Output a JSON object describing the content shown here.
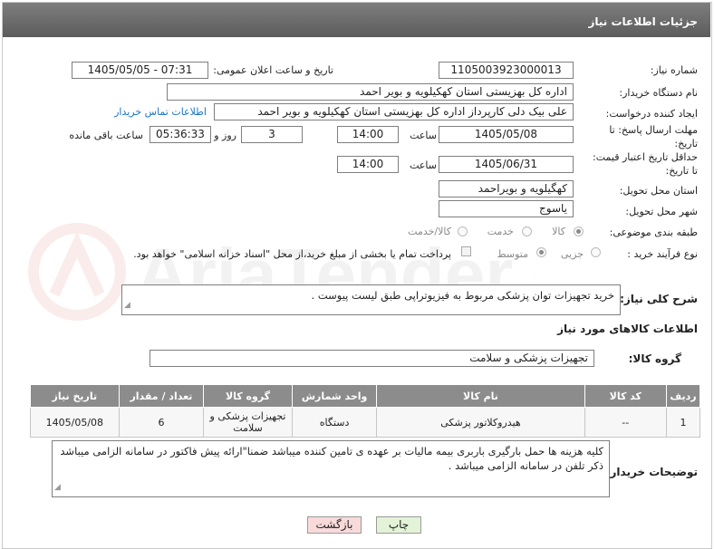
{
  "header": {
    "title": "جزئیات اطلاعات نیاز"
  },
  "watermark": {
    "text": "AriaTender.net"
  },
  "form": {
    "need_number": {
      "label": "شماره نیاز:",
      "value": "1105003923000013"
    },
    "announce_datetime": {
      "label": "تاریخ و ساعت اعلان عمومی:",
      "value": "1405/05/05 - 07:31"
    },
    "buyer_org": {
      "label": "نام دستگاه خریدار:",
      "value": "اداره کل بهزیستی استان کهکیلویه و بویر احمد"
    },
    "requester": {
      "label": "ایجاد کننده درخواست:",
      "value": "علی بیک دلی کارپرداز اداره کل بهزیستی استان کهکیلویه و بویر احمد",
      "contact_link": "اطلاعات تماس خریدار"
    },
    "deadline": {
      "label_line1": "مهلت ارسال پاسخ: تا",
      "label_line2": "تاریخ:",
      "date": "1405/05/08",
      "time_label": "ساعت",
      "time": "14:00",
      "days": "3",
      "days_label": "روز و",
      "remaining": "05:36:33",
      "remaining_label": "ساعت باقی مانده"
    },
    "price_validity": {
      "label_line1": "حداقل تاریخ اعتبار قیمت:",
      "label_line2": "تا تاریخ:",
      "date": "1405/06/31",
      "time_label": "ساعت",
      "time": "14:00"
    },
    "province": {
      "label": "استان محل تحویل:",
      "value": "کهگیلویه و بویراحمد"
    },
    "city": {
      "label": "شهر محل تحویل:",
      "value": "یاسوج"
    },
    "category": {
      "label": "طبقه بندی موضوعی:",
      "options": [
        {
          "label": "کالا",
          "selected": true
        },
        {
          "label": "خدمت",
          "selected": false
        },
        {
          "label": "کالا/خدمت",
          "selected": false
        }
      ]
    },
    "purchase_process": {
      "label": "نوع فرآیند خرید :",
      "options": [
        {
          "label": "جزیی",
          "selected": false
        },
        {
          "label": "متوسط",
          "selected": true
        }
      ],
      "payment_note": "پرداخت تمام یا بخشی از مبلغ خرید،از محل \"اسناد خزانه اسلامی\" خواهد بود."
    },
    "general_description": {
      "label": "شرح کلی نیاز:",
      "value": "خرید تجهیزات توان پزشکی مربوط به فیزیوتراپی طبق لیست پیوست ."
    }
  },
  "goods_section": {
    "title": "اطلاعات کالاهای مورد نیاز",
    "group_label": "گروه کالا:",
    "group_value": "تجهیزات پزشکی و سلامت",
    "columns": [
      "ردیف",
      "کد کالا",
      "نام کالا",
      "واحد شمارش",
      "گروه کالا",
      "تعداد / مقدار",
      "تاریخ نیاز"
    ],
    "rows": [
      [
        "1",
        "--",
        "هیدروکلاتور پزشکی",
        "دستگاه",
        "تجهیزات پزشکی و سلامت",
        "6",
        "1405/05/08"
      ]
    ]
  },
  "buyer_notes": {
    "label": "توضیحات خریدار:",
    "value": "کلیه هزینه ها حمل بارگیری باربری  بیمه مالیات بر عهده ی تامین کننده میباشد ضمنا\"ارائه پیش فاکتور در سامانه الزامی میباشد ذکر تلفن در سامانه الزامی میباشد ."
  },
  "actions": {
    "print_label": "چاپ",
    "back_label": "بازگشت"
  },
  "colors": {
    "header_bg": "#6b6b6b",
    "link": "#1a73c8",
    "table_header_bg": "#8c8c8c",
    "back_button_bg": "#f9dada",
    "print_button_bg": "#e3f3d7"
  }
}
